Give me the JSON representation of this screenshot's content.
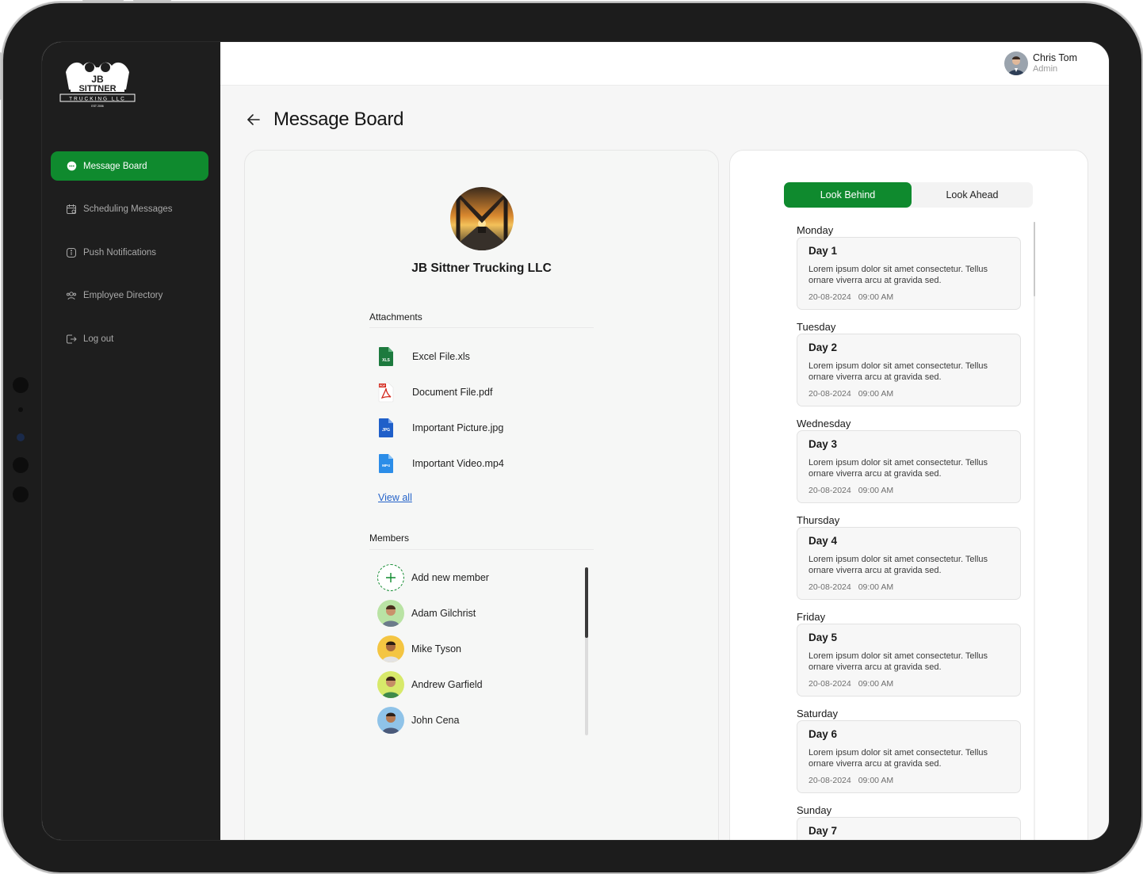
{
  "sidebar": {
    "logo": {
      "line1": "JB",
      "line2": "SITTNER",
      "line3": "TRUCKING LLC",
      "line4": "EST 2006"
    },
    "items": [
      {
        "label": "Message Board",
        "icon": "chat-bubble-icon",
        "active": true
      },
      {
        "label": "Scheduling Messages",
        "icon": "calendar-icon",
        "active": false
      },
      {
        "label": "Push Notifications",
        "icon": "info-icon",
        "active": false
      },
      {
        "label": "Employee Directory",
        "icon": "users-icon",
        "active": false
      },
      {
        "label": "Log out",
        "icon": "logout-icon",
        "active": false
      }
    ]
  },
  "topbar": {
    "user_name": "Chris Tom",
    "user_role": "Admin"
  },
  "page": {
    "title": "Message Board"
  },
  "company": {
    "name": "JB Sittner Trucking LLC"
  },
  "attachments": {
    "title": "Attachments",
    "files": [
      {
        "name": "Excel File.xls",
        "type": "xls-icon",
        "badge": "XLS",
        "color": "#1d7a3e"
      },
      {
        "name": "Document File.pdf",
        "type": "pdf-icon",
        "badge": "PDF",
        "color": "#d42b1f"
      },
      {
        "name": "Important Picture.jpg",
        "type": "jpg-icon",
        "badge": "JPG",
        "color": "#1f5fc9"
      },
      {
        "name": "Important Video.mp4",
        "type": "mp4-icon",
        "badge": "MP4",
        "color": "#2b8de8"
      }
    ],
    "view_all": "View all"
  },
  "members": {
    "title": "Members",
    "add_label": "Add new member",
    "list": [
      {
        "name": "Adam Gilchrist",
        "bg": "#b9e3a4"
      },
      {
        "name": "Mike Tyson",
        "bg": "#f4c542"
      },
      {
        "name": "Andrew Garfield",
        "bg": "#d7e96a"
      },
      {
        "name": "John Cena",
        "bg": "#8fc3e8"
      }
    ]
  },
  "schedule": {
    "tabs": {
      "behind": "Look Behind",
      "ahead": "Look Ahead"
    },
    "days": [
      {
        "day": "Monday",
        "title": "Day 1",
        "desc": "Lorem ipsum dolor sit amet consectetur. Tellus ornare viverra arcu at gravida sed.",
        "date": "20-08-2024",
        "time": "09:00 AM"
      },
      {
        "day": "Tuesday",
        "title": "Day 2",
        "desc": "Lorem ipsum dolor sit amet consectetur. Tellus ornare viverra arcu at gravida sed.",
        "date": "20-08-2024",
        "time": "09:00 AM"
      },
      {
        "day": "Wednesday",
        "title": "Day 3",
        "desc": "Lorem ipsum dolor sit amet consectetur. Tellus ornare viverra arcu at gravida sed.",
        "date": "20-08-2024",
        "time": "09:00 AM"
      },
      {
        "day": "Thursday",
        "title": "Day 4",
        "desc": "Lorem ipsum dolor sit amet consectetur. Tellus ornare viverra arcu at gravida sed.",
        "date": "20-08-2024",
        "time": "09:00 AM"
      },
      {
        "day": "Friday",
        "title": "Day 5",
        "desc": "Lorem ipsum dolor sit amet consectetur. Tellus ornare viverra arcu at gravida sed.",
        "date": "20-08-2024",
        "time": "09:00 AM"
      },
      {
        "day": "Saturday",
        "title": "Day 6",
        "desc": "Lorem ipsum dolor sit amet consectetur. Tellus ornare viverra arcu at gravida sed.",
        "date": "20-08-2024",
        "time": "09:00 AM"
      },
      {
        "day": "Sunday",
        "title": "Day 7",
        "desc": "",
        "date": "",
        "time": ""
      }
    ]
  },
  "colors": {
    "accent": "#0f8a2e",
    "sidebar_bg": "#1e1e1e",
    "link": "#2563c9"
  }
}
